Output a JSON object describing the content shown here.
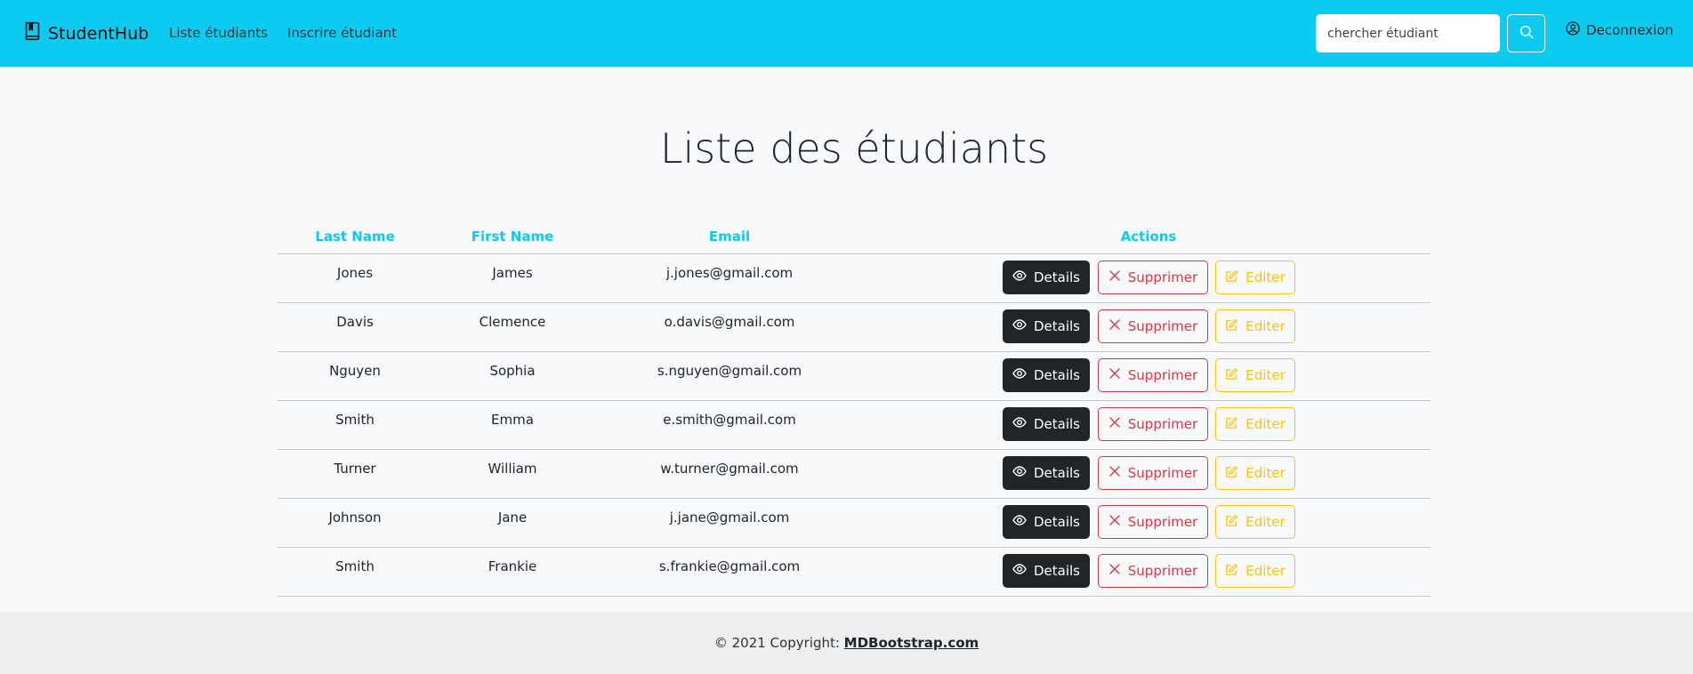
{
  "navbar": {
    "brand": "StudentHub",
    "links": [
      "Liste étudiants",
      "Inscrire étudiant"
    ],
    "search": {
      "placeholder": "chercher étudiant",
      "value": ""
    },
    "logout_label": "Deconnexion",
    "background": "#0dcaf0"
  },
  "page": {
    "title": "Liste des étudiants"
  },
  "table": {
    "headers": [
      "Last Name",
      "First Name",
      "Email",
      "Actions"
    ],
    "rows": [
      {
        "last": "Jones",
        "first": "James",
        "email": "j.jones@gmail.com"
      },
      {
        "last": "Davis",
        "first": "Clemence",
        "email": "o.davis@gmail.com"
      },
      {
        "last": "Nguyen",
        "first": "Sophia",
        "email": "s.nguyen@gmail.com"
      },
      {
        "last": "Smith",
        "first": "Emma",
        "email": "e.smith@gmail.com"
      },
      {
        "last": "Turner",
        "first": "William",
        "email": "w.turner@gmail.com"
      },
      {
        "last": "Johnson",
        "first": "Jane",
        "email": "j.jane@gmail.com"
      },
      {
        "last": "Smith",
        "first": "Frankie",
        "email": "s.frankie@gmail.com"
      }
    ],
    "actions": {
      "details": "Details",
      "delete": "Supprimer",
      "edit": "Editer"
    },
    "icons": {
      "details": "eye-icon",
      "delete": "x-icon",
      "edit": "edit-icon"
    },
    "colors": {
      "header": "#0dcaf0",
      "details": "#212529",
      "delete": "#dc3545",
      "edit": "#ffc107"
    }
  },
  "footer": {
    "prefix": "© 2021 Copyright: ",
    "link": "MDBootstrap.com"
  }
}
